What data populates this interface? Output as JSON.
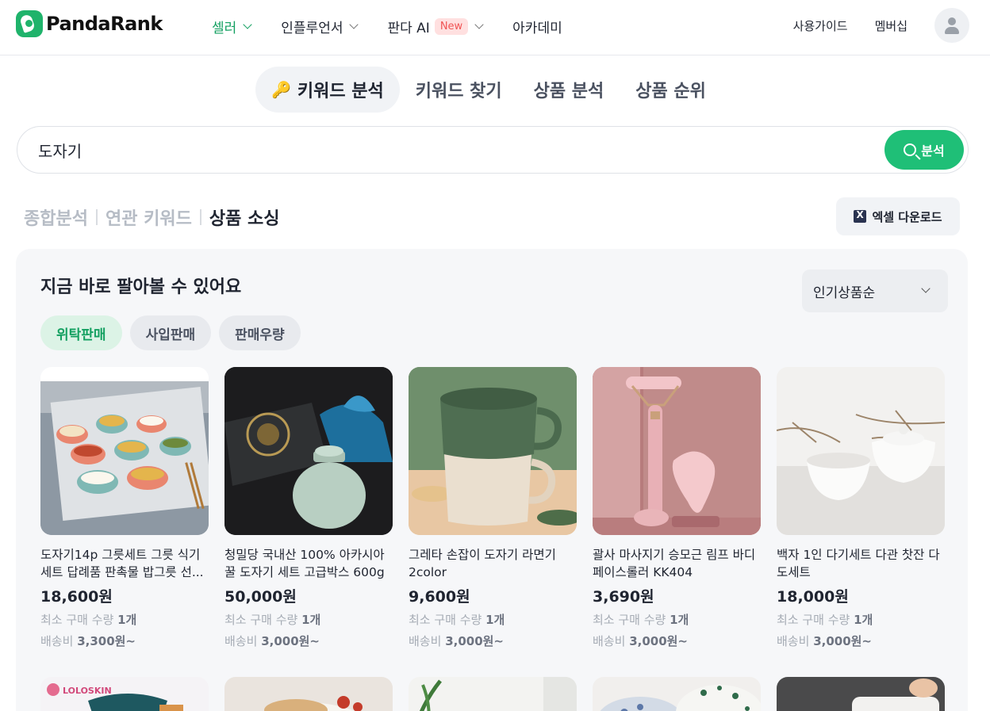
{
  "header": {
    "logo_text": "PandaRank",
    "nav": [
      {
        "label": "셀러",
        "has_dropdown": true,
        "active": true
      },
      {
        "label": "인플루언서",
        "has_dropdown": true
      },
      {
        "label": "판다 AI",
        "badge": "New",
        "has_dropdown": true
      },
      {
        "label": "아카데미"
      }
    ],
    "right_links": [
      "사용가이드",
      "멤버십"
    ]
  },
  "tabs": [
    {
      "label": "키워드 분석",
      "active": true,
      "icon": "key-icon"
    },
    {
      "label": "키워드 찾기"
    },
    {
      "label": "상품 분석"
    },
    {
      "label": "상품 순위"
    }
  ],
  "search": {
    "value": "도자기",
    "button_label": "분석"
  },
  "subtabs": [
    {
      "label": "종합분석"
    },
    {
      "label": "연관 키워드"
    },
    {
      "label": "상품 소싱",
      "active": true
    }
  ],
  "excel_button": "엑셀 다운로드",
  "panel": {
    "title": "지금 바로 팔아볼 수 있어요",
    "sort_label": "인기상품순",
    "chips": [
      {
        "label": "위탁판매",
        "active": true
      },
      {
        "label": "사입판매"
      },
      {
        "label": "판매우량"
      }
    ],
    "min_qty_label": "최소 구매 수량",
    "shipping_label": "배송비",
    "products": [
      {
        "name": "도자기14p 그릇세트 그릇 식기 세트 답례품 판촉물 밥그릇 선...",
        "price": "18,600원",
        "min_qty": "1개",
        "shipping": "3,300원~"
      },
      {
        "name": "청밀당 국내산 100% 아카시아 꿀 도자기 세트 고급박스 600g",
        "price": "50,000원",
        "min_qty": "1개",
        "shipping": "3,000원~"
      },
      {
        "name": "그레타 손잡이 도자기 라면기 2color",
        "price": "9,600원",
        "min_qty": "1개",
        "shipping": "3,000원~"
      },
      {
        "name": "괄사 마사지기 승모근 림프 바디 페이스롤러 KK404",
        "price": "3,690원",
        "min_qty": "1개",
        "shipping": "3,000원~"
      },
      {
        "name": "백자 1인 다기세트 다관 찻잔 다도세트",
        "price": "18,000원",
        "min_qty": "1개",
        "shipping": "3,000원~"
      }
    ],
    "row2_brand": "LOLOSKIN"
  }
}
